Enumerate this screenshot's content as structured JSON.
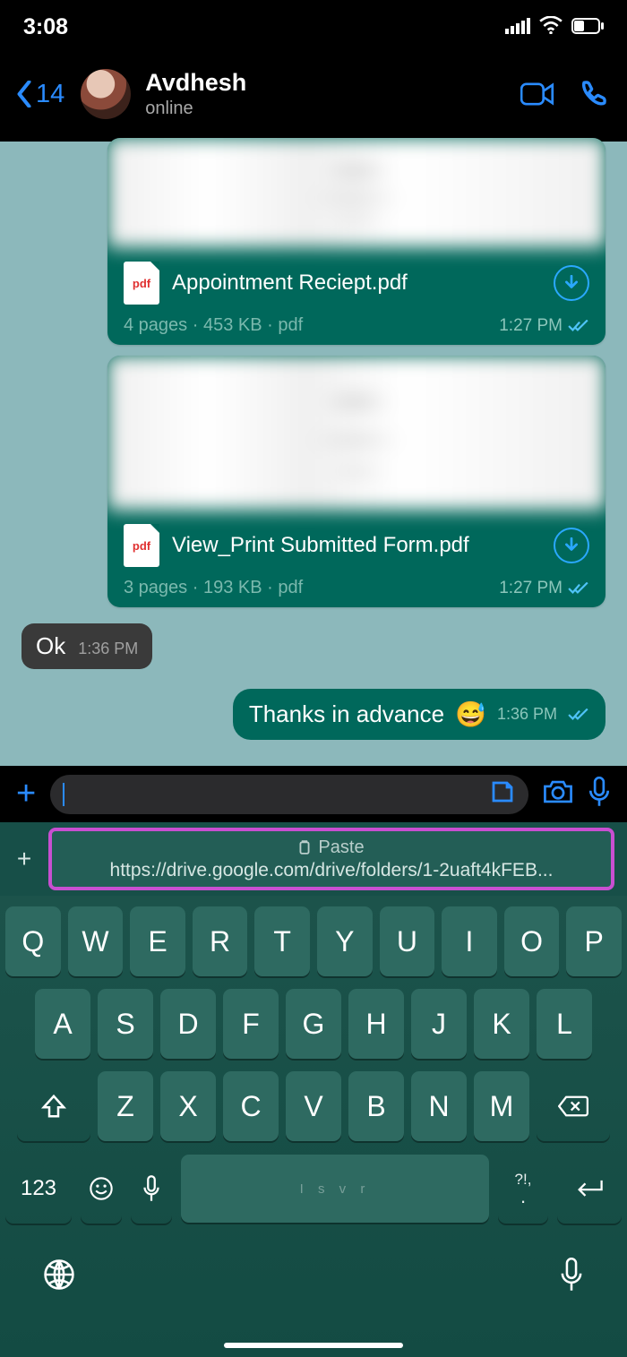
{
  "status": {
    "time": "3:08"
  },
  "nav": {
    "back_count": "14",
    "name": "Avdhesh",
    "presence": "online"
  },
  "docs": [
    {
      "name": "Appointment Reciept.pdf",
      "meta": "4 pages · 453 KB · pdf",
      "time": "1:27 PM",
      "icon": "pdf"
    },
    {
      "name": "View_Print Submitted Form.pdf",
      "meta": "3 pages · 193 KB · pdf",
      "time": "1:27 PM",
      "icon": "pdf"
    }
  ],
  "msg_in": {
    "text": "Ok",
    "time": "1:36 PM"
  },
  "msg_out": {
    "text": "Thanks in advance",
    "emoji": "😅",
    "time": "1:36 PM"
  },
  "paste": {
    "label": "Paste",
    "url": "https://drive.google.com/drive/folders/1-2uaft4kFEB..."
  },
  "kb": {
    "r1": [
      "Q",
      "W",
      "E",
      "R",
      "T",
      "Y",
      "U",
      "I",
      "O",
      "P"
    ],
    "r2": [
      "A",
      "S",
      "D",
      "F",
      "G",
      "H",
      "J",
      "K",
      "L"
    ],
    "r3": [
      "Z",
      "X",
      "C",
      "V",
      "B",
      "N",
      "M"
    ],
    "num": "123",
    "punct_top": "?!,",
    "punct_bot": ".",
    "space_hint": "I   s   v   r"
  }
}
